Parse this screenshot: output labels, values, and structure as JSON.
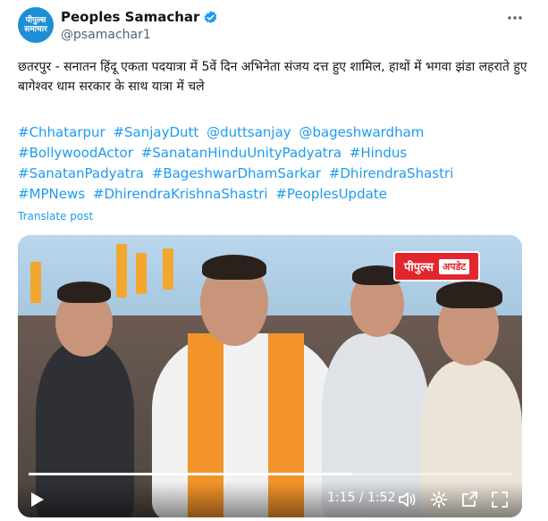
{
  "post": {
    "author": {
      "display_name": "Peoples Samachar",
      "handle": "@psamachar1",
      "avatar_text": [
        "पीपुल्स",
        "समाचार"
      ],
      "verified": true
    },
    "body": "छतरपुर - सनातन हिंदू एकता पदयात्रा में 5वें दिन अभिनेता संजय दत्त हुए शामिल, हाथों में भगवा झंडा लहराते हुए बागेश्वर धाम सरकार के साथ यात्रा में चले",
    "hashtags": [
      "#Chhatarpur",
      "#SanjayDutt",
      "@duttsanjay",
      "@bageshwardham",
      "#BollywoodActor",
      "#SanatanHinduUnityPadyatra",
      "#Hindus",
      "#SanatanPadyatra",
      "#BageshwarDhamSarkar",
      "#DhirendraShastri",
      "#MPNews",
      "#DhirendraKrishnaShastri",
      "#PeoplesUpdate"
    ],
    "translate_label": "Translate post"
  },
  "video": {
    "watermark": {
      "main": "पीपुल्स",
      "sub": "अपडेट"
    },
    "time_display": "1:15 / 1:52",
    "progress": 0.67
  },
  "icons": {
    "more": "more-icon",
    "verified": "verified-badge-icon",
    "play": "play-icon",
    "volume": "volume-icon",
    "settings": "settings-icon",
    "pip": "picture-in-picture-icon",
    "fullscreen": "fullscreen-icon"
  },
  "colors": {
    "link": "#1d9bf0",
    "verified": "#1d9bf0",
    "watermark": "#e3262d"
  }
}
